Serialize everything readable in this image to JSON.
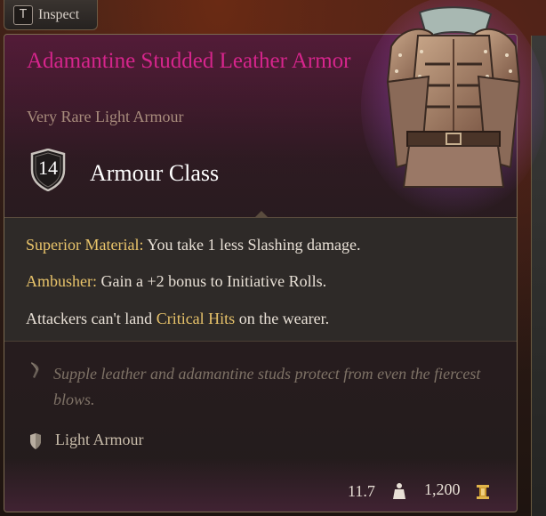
{
  "inspect": {
    "key": "T",
    "label": "Inspect"
  },
  "item": {
    "name": "Adamantine Studded Leather Armor",
    "rarity_type": "Very Rare Light Armour",
    "rarity_color": "#d6258c",
    "armour_class": {
      "value": "14",
      "label": "Armour Class"
    }
  },
  "properties": [
    {
      "name": "Superior Material:",
      "text": " You take 1 less Slashing damage."
    },
    {
      "name": "Ambusher:",
      "text": " Gain a +2 bonus to Initiative Rolls."
    },
    {
      "pre": "Attackers can't land ",
      "highlight": "Critical Hits",
      "post": " on the wearer."
    }
  ],
  "flavor_text": "Supple leather and adamantine studs protect from even the fiercest blows.",
  "category": "Light Armour",
  "footer": {
    "weight": "11.7",
    "price": "1,200"
  },
  "icons": {
    "ac": "shield-icon",
    "flavor": "quill-icon",
    "category": "light-armour-shield-icon",
    "weight": "weight-icon",
    "gold": "gold-coin-icon"
  }
}
